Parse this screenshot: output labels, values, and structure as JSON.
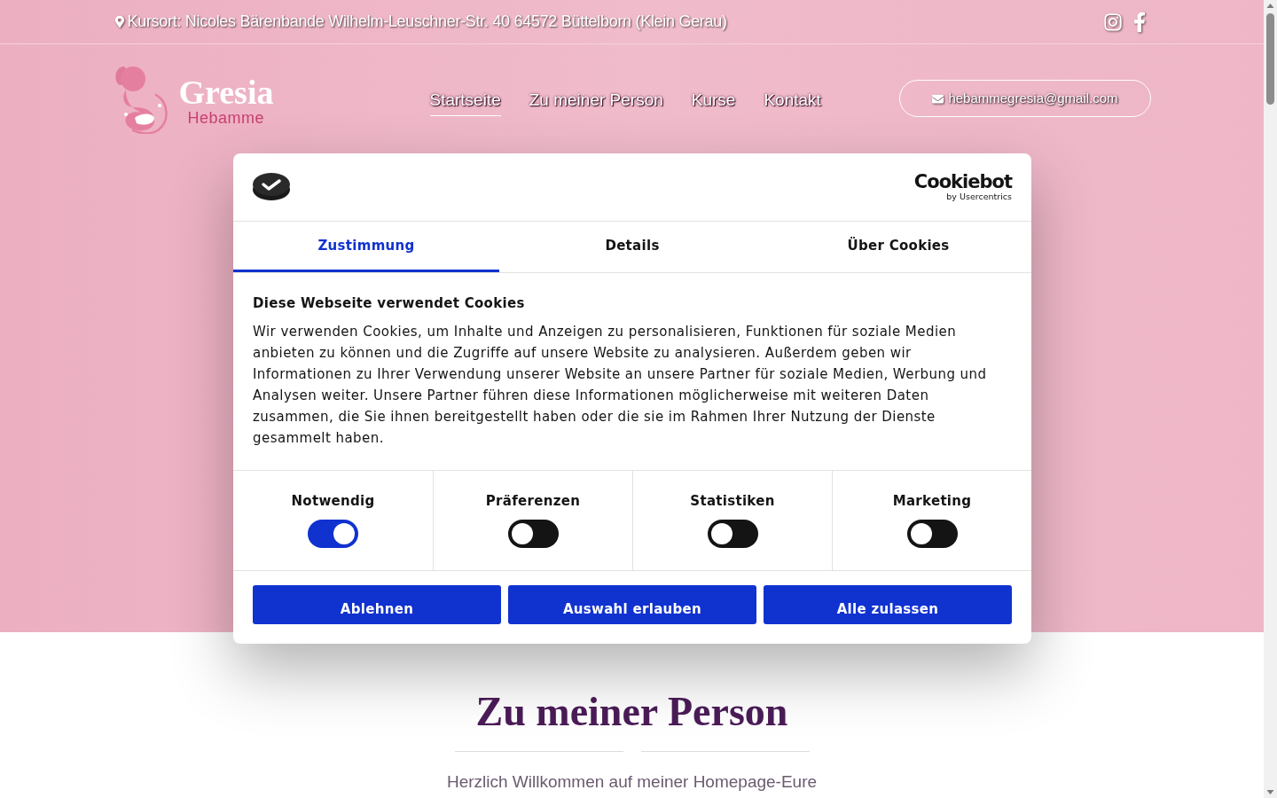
{
  "top_bar": {
    "address": "Kursort: Nicoles Bärenbande Wilhelm-Leuschner-Str. 40 64572 Büttelborn (Klein Gerau)"
  },
  "header": {
    "logo": {
      "name": "Gresia",
      "subtitle": "Hebamme"
    },
    "nav": [
      {
        "label": "Startseite",
        "selected": true
      },
      {
        "label": "Zu meiner Person",
        "selected": false
      },
      {
        "label": "Kurse",
        "selected": false
      },
      {
        "label": "Kontakt",
        "selected": false
      }
    ],
    "email": "hebammegresia@gmail.com"
  },
  "cookie_dialog": {
    "brand": {
      "name": "Cookiebot",
      "tagline": "by Usercentrics"
    },
    "tabs": [
      {
        "label": "Zustimmung",
        "selected": true
      },
      {
        "label": "Details",
        "selected": false
      },
      {
        "label": "Über Cookies",
        "selected": false
      }
    ],
    "title": "Diese Webseite verwendet Cookies",
    "text": "Wir verwenden Cookies, um Inhalte und Anzeigen zu personalisieren, Funktionen für soziale Medien anbieten zu können und die Zugriffe auf unsere Website zu analysieren. Außerdem geben wir Informationen zu Ihrer Verwendung unserer Website an unsere Partner für soziale Medien, Werbung und Analysen weiter. Unsere Partner führen diese Informationen möglicherweise mit weiteren Daten zusammen, die Sie ihnen bereitgestellt haben oder die sie im Rahmen Ihrer Nutzung der Dienste gesammelt haben.",
    "toggles": [
      {
        "label": "Notwendig",
        "on": true
      },
      {
        "label": "Präferenzen",
        "on": false
      },
      {
        "label": "Statistiken",
        "on": false
      },
      {
        "label": "Marketing",
        "on": false
      }
    ],
    "buttons": [
      "Ablehnen",
      "Auswahl erlauben",
      "Alle zulassen"
    ]
  },
  "section": {
    "heading": "Zu meiner Person",
    "intro": "Herzlich Willkommen auf meiner Homepage-Eure"
  }
}
